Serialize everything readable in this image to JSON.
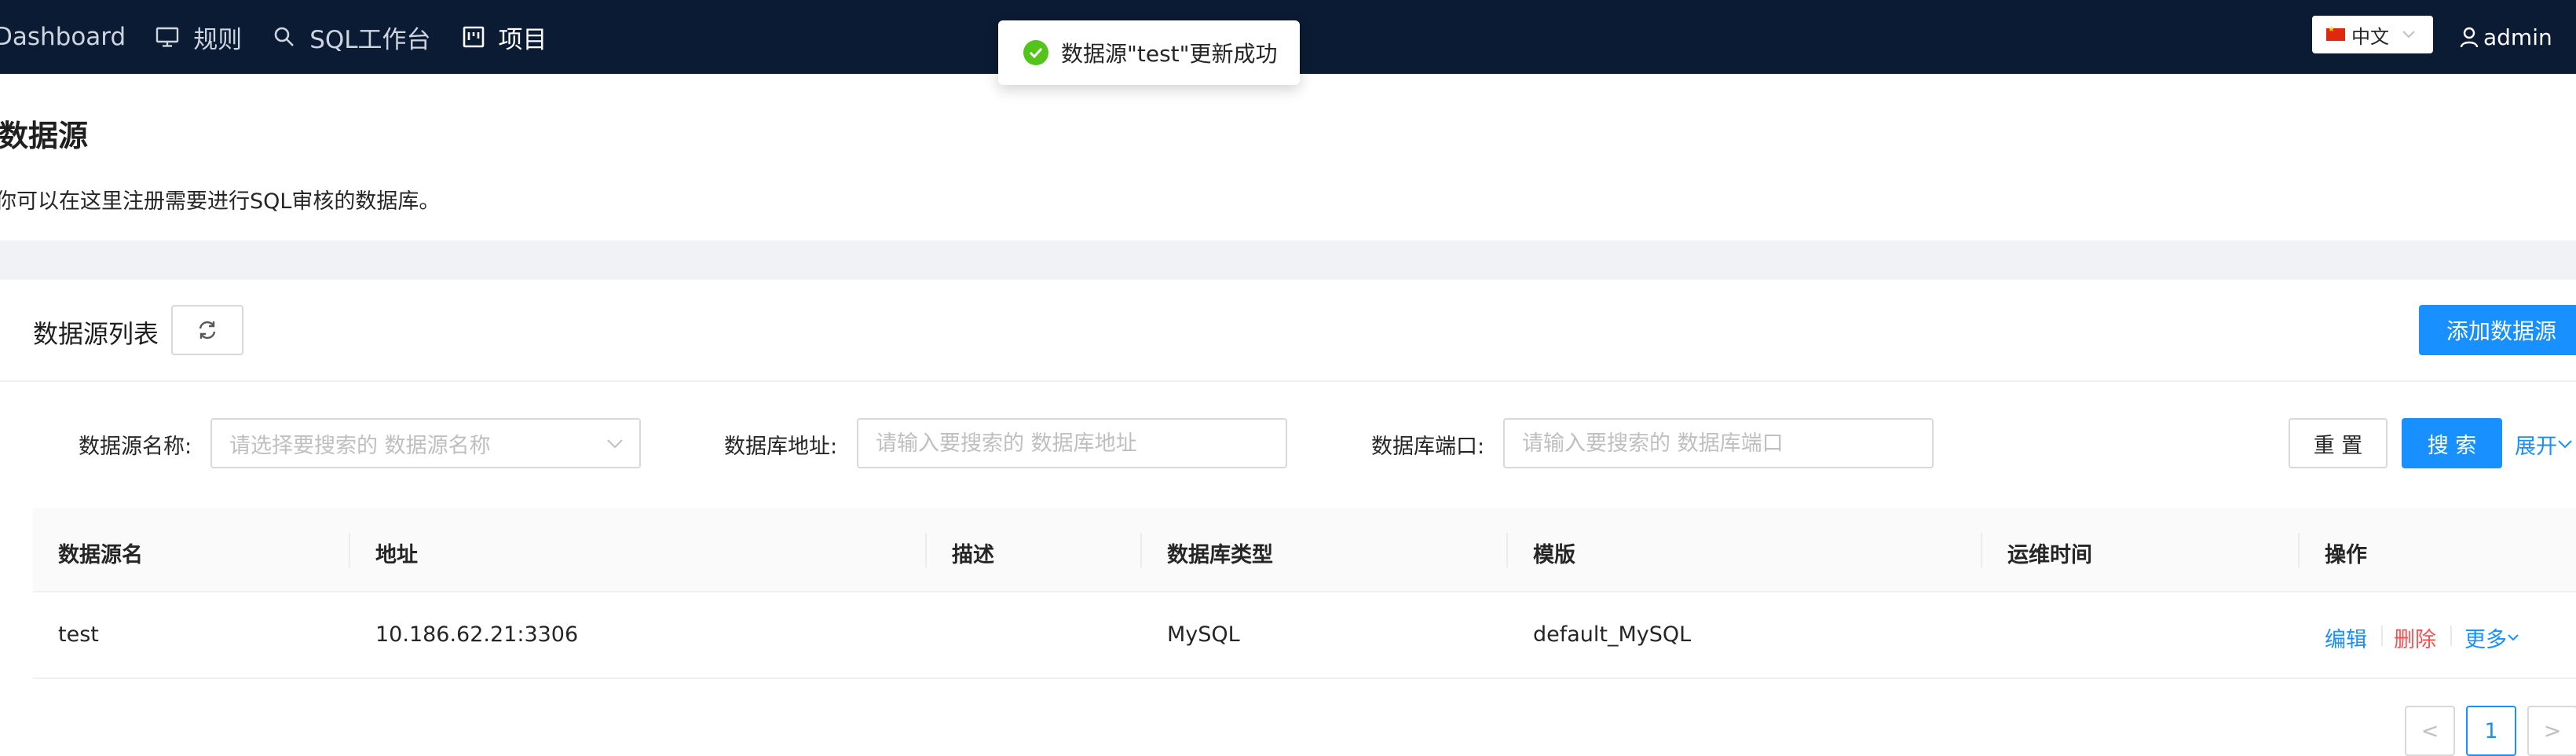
{
  "nav": {
    "dashboard": "Dashboard",
    "rules": "规则",
    "sql_workbench": "SQL工作台",
    "project": "项目"
  },
  "lang": {
    "label": "中文"
  },
  "user": {
    "name": "admin"
  },
  "toast": {
    "message": "数据源\"test\"更新成功"
  },
  "page": {
    "title": "数据源",
    "description": "你可以在这里注册需要进行SQL审核的数据库。"
  },
  "card": {
    "title": "数据源列表",
    "add_label": "添加数据源"
  },
  "filters": {
    "name_label": "数据源名称:",
    "name_placeholder": "请选择要搜索的 数据源名称",
    "host_label": "数据库地址:",
    "host_placeholder": "请输入要搜索的 数据库地址",
    "port_label": "数据库端口:",
    "port_placeholder": "请输入要搜索的 数据库端口",
    "reset_label": "重 置",
    "search_label": "搜 索",
    "expand_label": "展开"
  },
  "table": {
    "columns": [
      "数据源名",
      "地址",
      "描述",
      "数据库类型",
      "模版",
      "运维时间",
      "操作"
    ],
    "rows": [
      {
        "name": "test",
        "address": "10.186.62.21:3306",
        "description": "",
        "db_type": "MySQL",
        "template": "default_MySQL",
        "maintenance": "",
        "actions": {
          "edit": "编辑",
          "delete": "删除",
          "more": "更多"
        }
      }
    ]
  },
  "pagination": {
    "prev": "<",
    "current": "1",
    "next": ">"
  },
  "colors": {
    "nav_bg": "#0b1b33",
    "primary": "#1890ff",
    "danger": "#ff4d4f",
    "success": "#52c41a",
    "band_bg": "#f0f2f5"
  }
}
